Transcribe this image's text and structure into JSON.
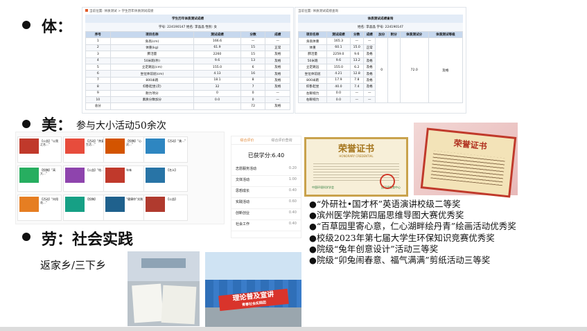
{
  "sections": {
    "ti": "体：",
    "mei": "美：",
    "mei_sub": "参与大小活动50余次",
    "lao": "劳：社会实践",
    "lao_sub": "返家乡/三下乡"
  },
  "fitness_left": {
    "breadcrumb": "当前位置: 体质测试 > 学生历年体质测试成绩",
    "title": "学生历年体质测试成绩",
    "info": "学号: 224190147    姓名: 李晶晶    性别: 女",
    "headers": [
      "序号",
      "项目名称",
      "测试成绩",
      "分数",
      "成绩"
    ],
    "rows": [
      [
        "1",
        "身高(cm)",
        "166.6",
        "—",
        "—"
      ],
      [
        "2",
        "体重(kg)",
        "61.9",
        "15",
        "正常"
      ],
      [
        "3",
        "肺活量",
        "2260",
        "15",
        "及格"
      ],
      [
        "4",
        "50米跑(秒)",
        "9.6",
        "13",
        "及格"
      ],
      [
        "5",
        "立定跳远(cm)",
        "155.0",
        "6",
        "及格"
      ],
      [
        "6",
        "坐位体前屈(cm)",
        "4.13",
        "16",
        "及格"
      ],
      [
        "7",
        "800米跑",
        "18.1",
        "8",
        "及格"
      ],
      [
        "8",
        "仰卧起坐(次)",
        "32",
        "7",
        "及格"
      ],
      [
        "9",
        "耐力项分",
        "0",
        "0",
        "—"
      ],
      [
        "10",
        "素质分数加分",
        "0.0",
        "0",
        "—"
      ]
    ],
    "total_label": "总分",
    "total_value": "72",
    "total_grade": "及格"
  },
  "fitness_right": {
    "breadcrumb": "当前位置: 体质测试成绩查询",
    "title": "体质测试成绩查询",
    "info": "姓名: 李晶晶      学号: 224190147",
    "headers": [
      "项目名称",
      "测试成绩",
      "分数",
      "成绩",
      "加分",
      "附分",
      "体质测试分",
      "体质测试等级"
    ],
    "rows": [
      [
        "身高体重",
        "165.3",
        "—",
        "—"
      ],
      [
        "体重",
        "60.1",
        "15.0",
        "正常"
      ],
      [
        "肺活量",
        "2259.0",
        "9.6",
        "及格"
      ],
      [
        "50米跑",
        "9.6",
        "13.2",
        "及格"
      ],
      [
        "立定跳远",
        "155.0",
        "6.2",
        "及格"
      ],
      [
        "坐位体前屈",
        "4.21",
        "12.8",
        "及格"
      ],
      [
        "800米跑",
        "17.9",
        "7.8",
        "及格"
      ],
      [
        "仰卧起坐",
        "40.0",
        "7.4",
        "及格"
      ],
      [
        "左眼视力",
        "0.0",
        "—",
        "—"
      ],
      [
        "右眼视力",
        "0.0",
        "—",
        "—"
      ]
    ],
    "merged": {
      "bonus": "0",
      "score": "72.0",
      "level": "及格"
    }
  },
  "activity_screens": {
    "left_tiles": [
      "【公益】“以我之名...”",
      "【活动】“热爱生活...”",
      "【投稿】“心灵...”",
      "【活动】“美...”",
      "【投稿】“高大...”",
      "【公益】“绘...”",
      "年味",
      "【名义】",
      "【活动】“向阳花...”",
      "【投稿】",
      "“健康你”实践",
      "【公益】"
    ],
    "score_tabs": [
      "综合评价",
      "综合评价查询"
    ],
    "score_title": "已获学分:6.40",
    "score_items": [
      {
        "name": "志愿服务活动",
        "value": "0.20"
      },
      {
        "name": "文体活动",
        "value": "1.00"
      },
      {
        "name": "思想成长",
        "value": "0.40"
      },
      {
        "name": "实践活动",
        "value": "0.60"
      },
      {
        "name": "创新创业",
        "value": "0.40"
      },
      {
        "name": "社会工作",
        "value": "0.40"
      }
    ],
    "score_status": "未完成领取"
  },
  "certificates": {
    "left_title": "荣誉证书",
    "left_sub": "HONORARY CREDENTIAL",
    "left_footer": [
      "中国环境科学学会",
      "国环境教育中心"
    ],
    "right_title": "荣誉证书"
  },
  "awards": [
    "●“外研社•国才杯”英语演讲校级二等奖",
    "●滨州医学院第四届思维导图大赛优秀奖",
    "●“百草园里寄心意，仁心湖畔绘丹青”绘画活动优秀奖",
    "●校级2023年第七届大学生环保知识竞赛优秀奖",
    "●院级“兔年创意设计”活动三等奖",
    "●院级“卯兔闹春意、福气满满”剪纸活动三等奖"
  ],
  "practice": {
    "banner_text": "理论普及宣讲",
    "banner_sub": "青春社会实践团"
  }
}
